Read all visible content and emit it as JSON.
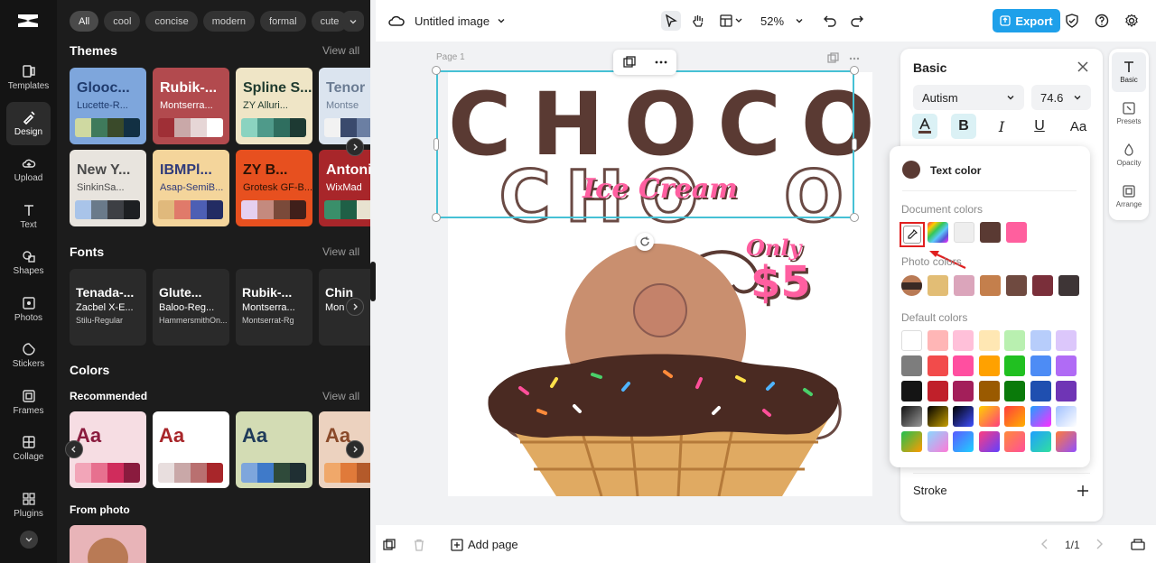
{
  "rail": {
    "items": [
      {
        "label": "Templates",
        "icon": "templates-icon"
      },
      {
        "label": "Design",
        "icon": "design-icon"
      },
      {
        "label": "Upload",
        "icon": "upload-icon"
      },
      {
        "label": "Text",
        "icon": "text-icon"
      },
      {
        "label": "Shapes",
        "icon": "shapes-icon"
      },
      {
        "label": "Photos",
        "icon": "photos-icon"
      },
      {
        "label": "Stickers",
        "icon": "stickers-icon"
      },
      {
        "label": "Frames",
        "icon": "frames-icon"
      },
      {
        "label": "Collage",
        "icon": "collage-icon"
      },
      {
        "label": "Plugins",
        "icon": "plugins-icon"
      }
    ]
  },
  "panel": {
    "chips": [
      "All",
      "cool",
      "concise",
      "modern",
      "formal",
      "cute"
    ],
    "themes_title": "Themes",
    "view_all": "View all",
    "themes": [
      {
        "t1": "Glooc...",
        "t2": "Lucette-R...",
        "bg": "#7ea6dc",
        "fg": "#1f3b6d",
        "sw": [
          "#cfd9a1",
          "#3f7a5b",
          "#3a4a2a",
          "#123043"
        ]
      },
      {
        "t1": "Rubik-...",
        "t2": "Montserra...",
        "bg": "#b24a4e",
        "fg": "#ffffff",
        "sw": [
          "#9f2f36",
          "#c9a8a8",
          "#e6d6d6",
          "#ffffff"
        ]
      },
      {
        "t1": "Spline S...",
        "t2": "ZY Alluri...",
        "bg": "#efe5c6",
        "fg": "#1f3a2e",
        "sw": [
          "#8bd3c0",
          "#4f9a8a",
          "#2f6e5f",
          "#1d3a33"
        ]
      },
      {
        "t1": "Tenor",
        "t2": "Montse",
        "bg": "#dbe4ef",
        "fg": "#6b7c93",
        "sw": [
          "#f2f2f2",
          "#3a4a6d",
          "#6b7fa3",
          "#a0b2cf"
        ]
      },
      {
        "t1": "New Y...",
        "t2": "SinkinSa...",
        "bg": "#e8e4de",
        "fg": "#4a4a4a",
        "sw": [
          "#a9c4e9",
          "#6a7a8a",
          "#3d3f44",
          "#1d1f22"
        ]
      },
      {
        "t1": "IBMPl...",
        "t2": "Asap-SemiB...",
        "bg": "#f4d59b",
        "fg": "#2f3a7a",
        "sw": [
          "#e0b97c",
          "#e07a6a",
          "#4d5fb4",
          "#232c63"
        ]
      },
      {
        "t1": "ZY B...",
        "t2": "Grotesk GF-B...",
        "bg": "#e7501f",
        "fg": "#2b1205",
        "sw": [
          "#e5d0f0",
          "#c48a7e",
          "#7a4a3a",
          "#3f1f1a"
        ]
      },
      {
        "t1": "Antonio",
        "t2": "WixMad",
        "bg": "#a8262a",
        "fg": "#ffffff",
        "sw": [
          "#3a8f6a",
          "#1f5f46",
          "#e8e2d0",
          "#cfcfcf"
        ]
      }
    ],
    "fonts_title": "Fonts",
    "fonts": [
      {
        "f1": "Tenada-...",
        "f2": "Zacbel X-E...",
        "f3": "Stilu-Regular"
      },
      {
        "f1": "Glute...",
        "f2": "Baloo-Reg...",
        "f3": "HammersmithOn..."
      },
      {
        "f1": "Rubik-...",
        "f2": "Montserra...",
        "f3": "Montserrat-Rg"
      },
      {
        "f1": "Chin",
        "f2": "Mon",
        "f3": ""
      }
    ],
    "colors_title": "Colors",
    "recommended_label": "Recommended",
    "color_cards": [
      {
        "aa": "Aa",
        "bg": "#f6dde3",
        "fg": "#8a1b3e",
        "sw": [
          "#f2a5b8",
          "#e7708f",
          "#d02c5c",
          "#8a1b3e"
        ]
      },
      {
        "aa": "Aa",
        "bg": "#ffffff",
        "fg": "#a8262a",
        "sw": [
          "#e8dede",
          "#c9a8a8",
          "#b97070",
          "#a8262a"
        ]
      },
      {
        "aa": "Aa",
        "bg": "#d3dcb4",
        "fg": "#1f3b5a",
        "sw": [
          "#7ea6dc",
          "#3f7ac9",
          "#2f4a3a",
          "#1f2f33"
        ]
      },
      {
        "aa": "Aa",
        "bg": "#ecd2bf",
        "fg": "#8a4a2a",
        "sw": [
          "#f0a86a",
          "#e07a3a",
          "#b45a2a",
          "#7a3a1a"
        ]
      }
    ],
    "from_photo_label": "From photo"
  },
  "topbar": {
    "title": "Untitled image",
    "zoom": "52%",
    "export": "Export"
  },
  "canvas": {
    "page_label": "Page 1",
    "choco": "CHOCO",
    "ice_cream": "Ice Cream",
    "only": "Only",
    "price": "$5"
  },
  "bottombar": {
    "add_page": "Add page",
    "page_count": "1/1"
  },
  "props": {
    "title": "Basic",
    "font": "Autism",
    "size": "74.6",
    "stroke": "Stroke"
  },
  "vtabs": [
    "Basic",
    "Presets",
    "Opacity",
    "Arrange"
  ],
  "color_popup": {
    "title": "Text color",
    "document_label": "Document colors",
    "document_colors": [
      "rainbow",
      "#eeeeee",
      "#5a3a33",
      "#ff5f9e"
    ],
    "photo_label": "Photo colors",
    "photo_colors": [
      "#e2bd75",
      "#dba5bb",
      "#c47f4c",
      "#6f4a40",
      "#7a2f3a",
      "#3e3536"
    ],
    "default_label": "Default colors",
    "default_colors": [
      [
        "#ffffff",
        "#ffb6b6",
        "#ffc0d9",
        "#ffe7b3",
        "#b9f0b0",
        "#b7cdfb",
        "#dcc7fb"
      ],
      [
        "#7d7d7d",
        "#f24b4b",
        "#ff4fa0",
        "#ffa100",
        "#21c021",
        "#4d8cf5",
        "#b06bf5"
      ],
      [
        "#141414",
        "#c0202a",
        "#a31f5a",
        "#9a5a00",
        "#0a7a0a",
        "#1f4fb0",
        "#6f35b5"
      ]
    ]
  }
}
